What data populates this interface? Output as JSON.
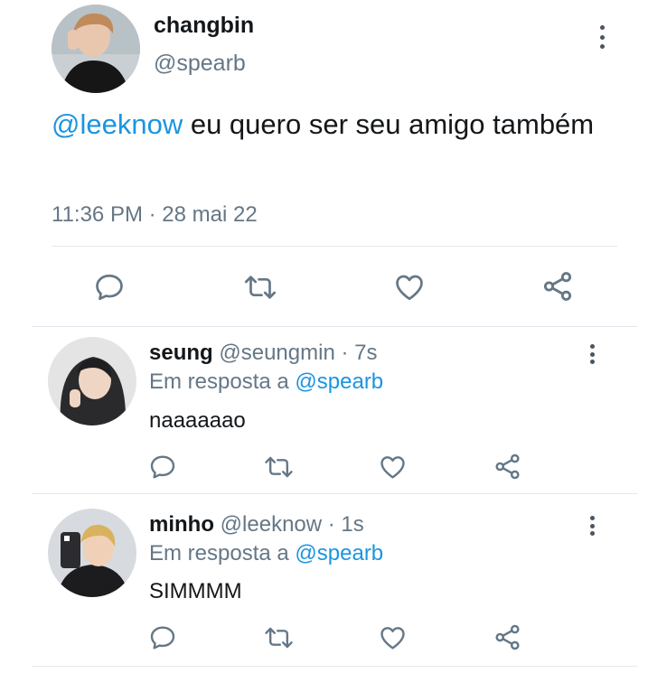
{
  "main_tweet": {
    "display_name": "changbin",
    "handle": "@spearb",
    "mention": "@leeknow",
    "text": " eu quero ser seu amigo também",
    "meta": "11:36 PM · 28 mai 22"
  },
  "replies": [
    {
      "display_name": "seung",
      "handle": "@seungmin",
      "sep": " · ",
      "time": "7s",
      "reply_prefix": "Em resposta a ",
      "reply_mention": "@spearb",
      "text": "naaaaaao"
    },
    {
      "display_name": "minho",
      "handle": "@leeknow",
      "sep": " · ",
      "time": "1s",
      "reply_prefix": "Em resposta a ",
      "reply_mention": "@spearb",
      "text": "SIMMMM"
    }
  ],
  "icons": {
    "reply": "reply-icon",
    "retweet": "retweet-icon",
    "like": "heart-icon",
    "share": "share-icon",
    "more": "more-vertical-icon"
  },
  "colors": {
    "mention": "#1b95e0",
    "secondary_text": "#657786",
    "primary_text": "#14171a",
    "divider": "#e1e8ed"
  }
}
